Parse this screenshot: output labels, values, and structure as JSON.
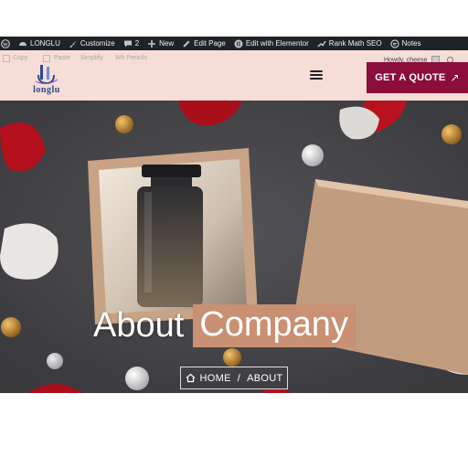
{
  "admin_bar": {
    "site_name": "LONGLU",
    "customize": "Customize",
    "comments_count": "2",
    "new": "New",
    "edit_page": "Edit Page",
    "edit_elementor": "Edit with Elementor",
    "rank_math": "Rank Math SEO",
    "notes": "Notes"
  },
  "header": {
    "logo_text": "longlu",
    "howdy": "Howdy, cheese",
    "cta_label": "GET A QUOTE",
    "cta_icon": "↗",
    "brand_color": "#8b0d3a",
    "faded_links": [
      "Copy",
      "Paste",
      "Simplify",
      "Wh Pencils"
    ]
  },
  "hero": {
    "title_word1": "About",
    "title_word2": "Company",
    "highlight_color": "#c99073",
    "breadcrumb_home": "HOME",
    "breadcrumb_sep": "/",
    "breadcrumb_current": "ABOUT"
  }
}
